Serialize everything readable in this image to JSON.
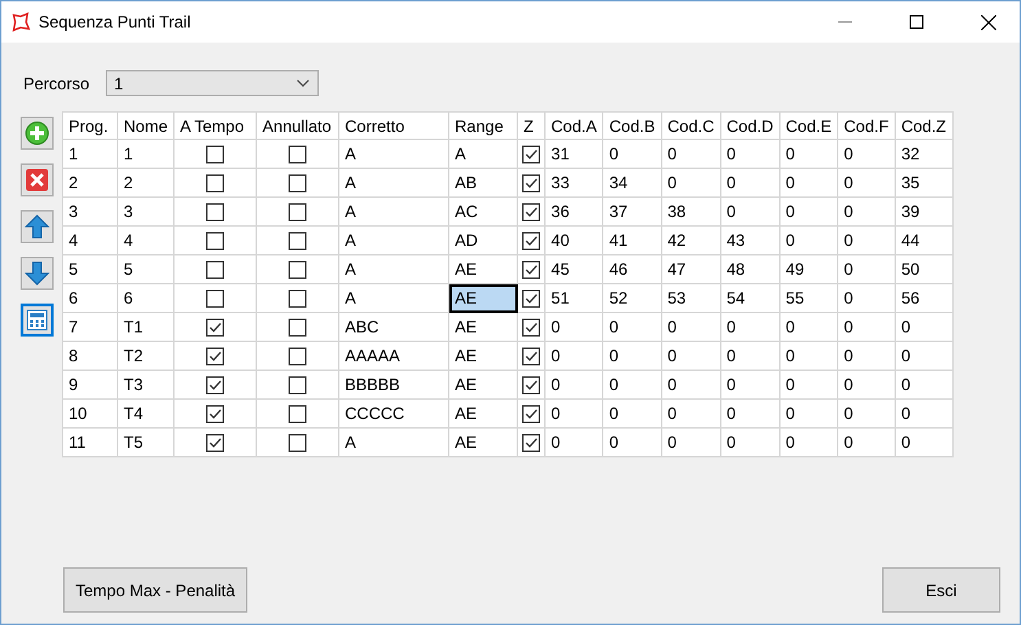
{
  "window": {
    "title": "Sequenza Punti Trail"
  },
  "percorso": {
    "label": "Percorso",
    "value": "1"
  },
  "table": {
    "columns": [
      "Prog.",
      "Nome",
      "A Tempo",
      "Annullato",
      "Corretto",
      "Range",
      "Z",
      "Cod.A",
      "Cod.B",
      "Cod.C",
      "Cod.D",
      "Cod.E",
      "Cod.F",
      "Cod.Z"
    ],
    "rows": [
      {
        "prog": "1",
        "nome": "1",
        "a_tempo": false,
        "annullato": false,
        "corretto": "A",
        "range": "A",
        "range_selected": false,
        "z": true,
        "codes": [
          "31",
          "0",
          "0",
          "0",
          "0",
          "0",
          "32"
        ]
      },
      {
        "prog": "2",
        "nome": "2",
        "a_tempo": false,
        "annullato": false,
        "corretto": "A",
        "range": "AB",
        "range_selected": false,
        "z": true,
        "codes": [
          "33",
          "34",
          "0",
          "0",
          "0",
          "0",
          "35"
        ]
      },
      {
        "prog": "3",
        "nome": "3",
        "a_tempo": false,
        "annullato": false,
        "corretto": "A",
        "range": "AC",
        "range_selected": false,
        "z": true,
        "codes": [
          "36",
          "37",
          "38",
          "0",
          "0",
          "0",
          "39"
        ]
      },
      {
        "prog": "4",
        "nome": "4",
        "a_tempo": false,
        "annullato": false,
        "corretto": "A",
        "range": "AD",
        "range_selected": false,
        "z": true,
        "codes": [
          "40",
          "41",
          "42",
          "43",
          "0",
          "0",
          "44"
        ]
      },
      {
        "prog": "5",
        "nome": "5",
        "a_tempo": false,
        "annullato": false,
        "corretto": "A",
        "range": "AE",
        "range_selected": false,
        "z": true,
        "codes": [
          "45",
          "46",
          "47",
          "48",
          "49",
          "0",
          "50"
        ]
      },
      {
        "prog": "6",
        "nome": "6",
        "a_tempo": false,
        "annullato": false,
        "corretto": "A",
        "range": "AE",
        "range_selected": true,
        "z": true,
        "codes": [
          "51",
          "52",
          "53",
          "54",
          "55",
          "0",
          "56"
        ]
      },
      {
        "prog": "7",
        "nome": "T1",
        "a_tempo": true,
        "annullato": false,
        "corretto": "ABC",
        "range": "AE",
        "range_selected": false,
        "z": true,
        "codes": [
          "0",
          "0",
          "0",
          "0",
          "0",
          "0",
          "0"
        ]
      },
      {
        "prog": "8",
        "nome": "T2",
        "a_tempo": true,
        "annullato": false,
        "corretto": "AAAAA",
        "range": "AE",
        "range_selected": false,
        "z": true,
        "codes": [
          "0",
          "0",
          "0",
          "0",
          "0",
          "0",
          "0"
        ]
      },
      {
        "prog": "9",
        "nome": "T3",
        "a_tempo": true,
        "annullato": false,
        "corretto": "BBBBB",
        "range": "AE",
        "range_selected": false,
        "z": true,
        "codes": [
          "0",
          "0",
          "0",
          "0",
          "0",
          "0",
          "0"
        ]
      },
      {
        "prog": "10",
        "nome": "T4",
        "a_tempo": true,
        "annullato": false,
        "corretto": "CCCCC",
        "range": "AE",
        "range_selected": false,
        "z": true,
        "codes": [
          "0",
          "0",
          "0",
          "0",
          "0",
          "0",
          "0"
        ]
      },
      {
        "prog": "11",
        "nome": "T5",
        "a_tempo": true,
        "annullato": false,
        "corretto": "A",
        "range": "AE",
        "range_selected": false,
        "z": true,
        "codes": [
          "0",
          "0",
          "0",
          "0",
          "0",
          "0",
          "0"
        ]
      }
    ]
  },
  "toolbar": [
    {
      "kind": "add",
      "selected": false
    },
    {
      "kind": "delete",
      "selected": false
    },
    {
      "kind": "up",
      "selected": false
    },
    {
      "kind": "down",
      "selected": false
    },
    {
      "kind": "calc",
      "selected": true
    }
  ],
  "buttons": [
    "Tempo Max - Penalità",
    "Esci"
  ]
}
